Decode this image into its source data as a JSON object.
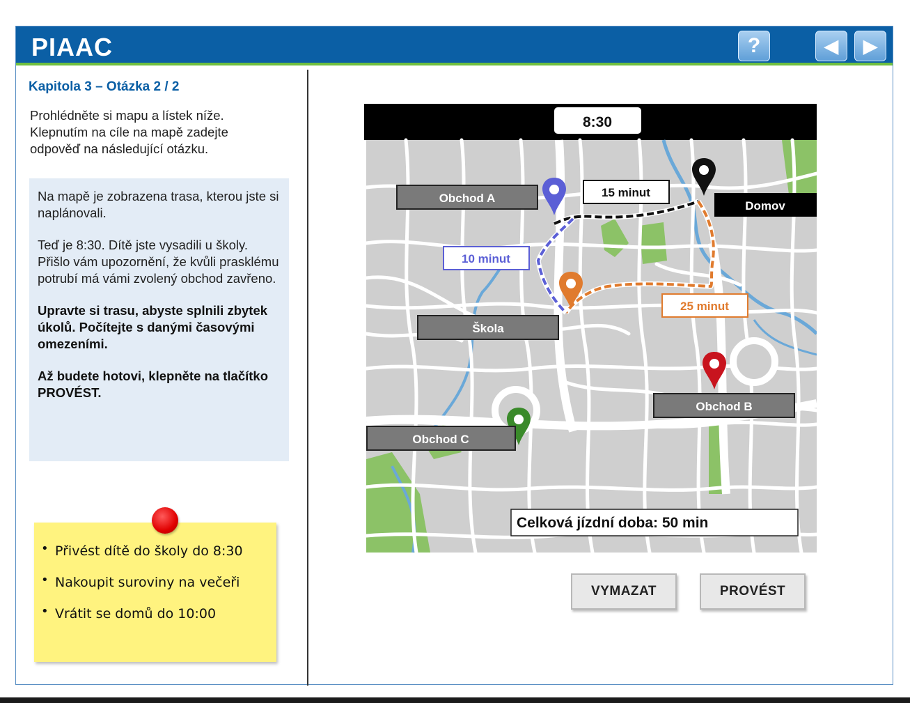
{
  "header": {
    "logo": "PIAAC",
    "help_label": "?",
    "back_label": "◀",
    "forward_label": "▶"
  },
  "left": {
    "chapter": "Kapitola 3 – Otázka 2 / 2",
    "intro": "Prohlédněte si mapu a lístek níže. Klepnutím na cíle na mapě zadejte odpověď na následující otázku.",
    "info": {
      "p1": "Na mapě je zobrazena trasa, kterou jste si naplánovali.",
      "p2": "Teď je 8:30. Dítě jste vysadili u školy. Přišlo vám upozornění, že kvůli prasklému potrubí má vámi zvolený obchod zavřeno.",
      "p3": "Upravte si trasu, abyste splnili zbytek úkolů. Počítejte s danými časovými omezeními.",
      "p4": "Až budete hotovi, klepněte na tlačítko PROVÉST."
    },
    "tasks": [
      "Přivést dítě do školy do 8:30",
      "Nakoupit suroviny na večeři",
      "Vrátit se domů do 10:00"
    ]
  },
  "map": {
    "time": "8:30",
    "labels": {
      "shop_a": "Obchod A",
      "home": "Domov",
      "school": "Škola",
      "shop_b": "Obchod B",
      "shop_c": "Obchod C"
    },
    "segments": {
      "black": "15 minut",
      "blue": "10 minut",
      "orange": "25 minut"
    },
    "total": "Celková jízdní doba: 50 min",
    "colors": {
      "blue_pin": "#5b5fd6",
      "orange_pin": "#e07b2e",
      "red_pin": "#c8141e",
      "green_pin": "#3a8a2a",
      "black_pin": "#111111"
    }
  },
  "buttons": {
    "clear": "VYMAZAT",
    "submit": "PROVÉST"
  }
}
